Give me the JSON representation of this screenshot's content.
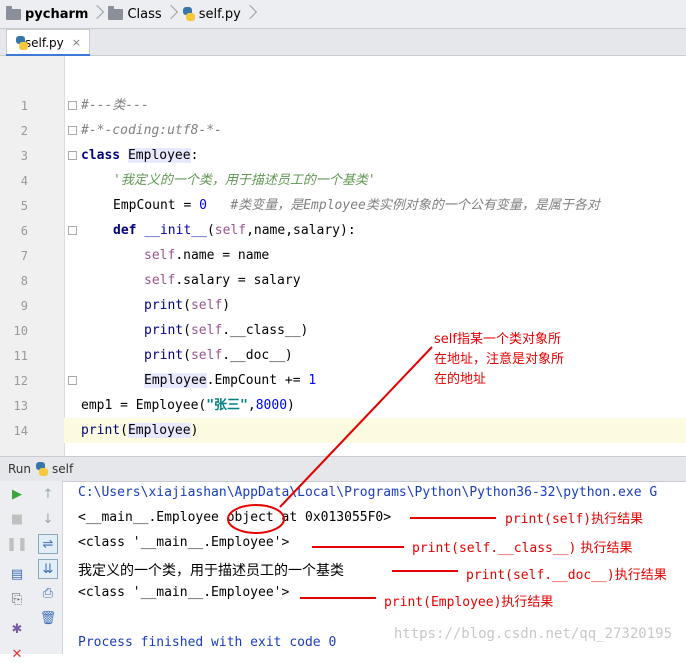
{
  "breadcrumb": [
    {
      "label": "pycharm",
      "icon": "folder-icon"
    },
    {
      "label": "Class",
      "icon": "folder-icon"
    },
    {
      "label": "self.py",
      "icon": "python-file-icon"
    }
  ],
  "tab": {
    "label": "self.py",
    "close": "×"
  },
  "code_lines": [
    {
      "n": "1",
      "text": "#---类---"
    },
    {
      "n": "2",
      "text": "#-*-coding:utf8-*-"
    },
    {
      "n": "3",
      "kw": "class ",
      "name": "Employee",
      "rest": ":"
    },
    {
      "n": "4",
      "text": "'我定义的一个类，用于描述员工的一个基类'"
    },
    {
      "n": "5",
      "pre": "EmpCount = ",
      "num": "0",
      "comment": "#类变量，是Employee类实例对象的一个公有变量，是属于各对"
    },
    {
      "n": "6",
      "kw": "def ",
      "name": "__init__",
      "s1": "(",
      "self": "self",
      "rest": ",name,salary):"
    },
    {
      "n": "7",
      "self": "self",
      "rest": ".name = name"
    },
    {
      "n": "8",
      "self": "self",
      "rest": ".salary = salary"
    },
    {
      "n": "9",
      "bi": "print",
      "s1": "(",
      "self": "self",
      "rest": ")"
    },
    {
      "n": "10",
      "bi": "print",
      "s1": "(",
      "self": "self",
      "rest": ".__class__)"
    },
    {
      "n": "11",
      "bi": "print",
      "s1": "(",
      "self": "self",
      "rest": ".__doc__)"
    },
    {
      "n": "12",
      "name": "Employee",
      "rest": ".EmpCount += ",
      "num": "1"
    },
    {
      "n": "13",
      "pre": "emp1 = Employee(",
      "str": "\"张三\"",
      "rest": ",",
      "num": "8000",
      "end": ")"
    },
    {
      "n": "14",
      "bi": "print",
      "s1": "(",
      "name": "Employee",
      "rest": ")"
    }
  ],
  "run": {
    "label": "Run",
    "config": "self"
  },
  "output": [
    "C:\\Users\\xiajiashan\\AppData\\Local\\Programs\\Python\\Python36-32\\python.exe G",
    "<__main__.Employee ",
    "object",
    " at 0x013055F0>",
    "<class '__main__.Employee'>",
    "我定义的一个类，用于描述员工的一个基类",
    "<class '__main__.Employee'>",
    "Process finished with exit code 0"
  ],
  "annotations": {
    "self_note": [
      "self指某一个类对象所",
      "在地址，注意是对象所",
      "在的地址"
    ],
    "a1": [
      "print(self)",
      "执行结果"
    ],
    "a2": [
      "print(self.__class__)",
      " 执行结果"
    ],
    "a3": [
      "print(self.__doc__)",
      "执行结果"
    ],
    "a4": [
      "print(Employee)",
      "执行结果"
    ]
  },
  "watermark": "https://blog.csdn.net/qq_27320195",
  "colors": {
    "annotation": "#e60000",
    "accent": "#3c7ad8"
  }
}
